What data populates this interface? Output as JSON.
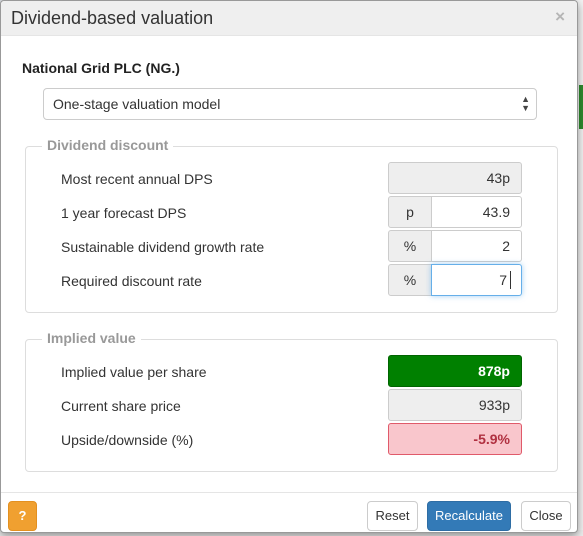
{
  "dialog": {
    "title": "Dividend-based valuation",
    "close_glyph": "×"
  },
  "company": "National Grid PLC (NG.)",
  "model_select": {
    "selected": "One-stage valuation model",
    "arrows": "▲▼"
  },
  "dividend_discount": {
    "legend": "Dividend discount",
    "rows": [
      {
        "label": "Most recent annual DPS",
        "value": "43p"
      },
      {
        "label": "1 year forecast DPS",
        "addon": "p",
        "value": "43.9"
      },
      {
        "label": "Sustainable dividend growth rate",
        "addon": "%",
        "value": "2"
      },
      {
        "label": "Required discount rate",
        "addon": "%",
        "value": "7"
      }
    ]
  },
  "implied_value": {
    "legend": "Implied value",
    "rows": [
      {
        "label": "Implied value per share",
        "value": "878p",
        "color": "#008000"
      },
      {
        "label": "Current share price",
        "value": "933p"
      },
      {
        "label": "Upside/downside (%)",
        "value": "-5.9%",
        "color": "#f9c6cc"
      }
    ]
  },
  "footer": {
    "help_label": "?",
    "reset_label": "Reset",
    "recalculate_label": "Recalculate",
    "close_label": "Close"
  }
}
